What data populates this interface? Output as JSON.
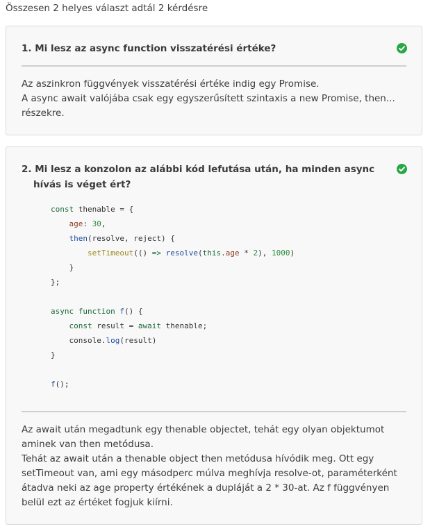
{
  "summary": "Összesen 2 helyes választ adtál 2 kérdésre",
  "colors": {
    "correct": "#28a745"
  },
  "questions": [
    {
      "title": "1. Mi lesz az async function visszatérési értéke?",
      "status_icon": "check-circle-icon",
      "answer": [
        "Az aszinkron függvények visszatérési értéke indig egy Promise.",
        "A async await valójába csak egy egyszerűsített szintaxis a new Promise, then... részekre."
      ]
    },
    {
      "title": "2. Mi lesz a konzolon az alábbi kód lefutása után, ha minden async hívás is véget ért?",
      "status_icon": "check-circle-icon",
      "code": [
        "const thenable = {",
        "    age: 30,",
        "    then(resolve, reject) {",
        "        setTimeout(() => resolve(this.age * 2), 1000)",
        "    }",
        "};",
        "",
        "async function f() {",
        "    const result = await thenable;",
        "    console.log(result)",
        "}",
        "",
        "f();"
      ],
      "answer": [
        "Az await után megadtunk egy thenable objectet, tehát egy olyan objektumot aminek van then metódusa.",
        "Tehát az await után a thenable object then metódusa hívódik meg. Ott egy setTimeout van, ami egy másodperc múlva meghívja resolve-ot, paraméterként átadva neki az age property értékének a dupláját a 2 * 30-at. Az f függvényen belül ezt az értéket fogjuk kiírni."
      ]
    }
  ]
}
